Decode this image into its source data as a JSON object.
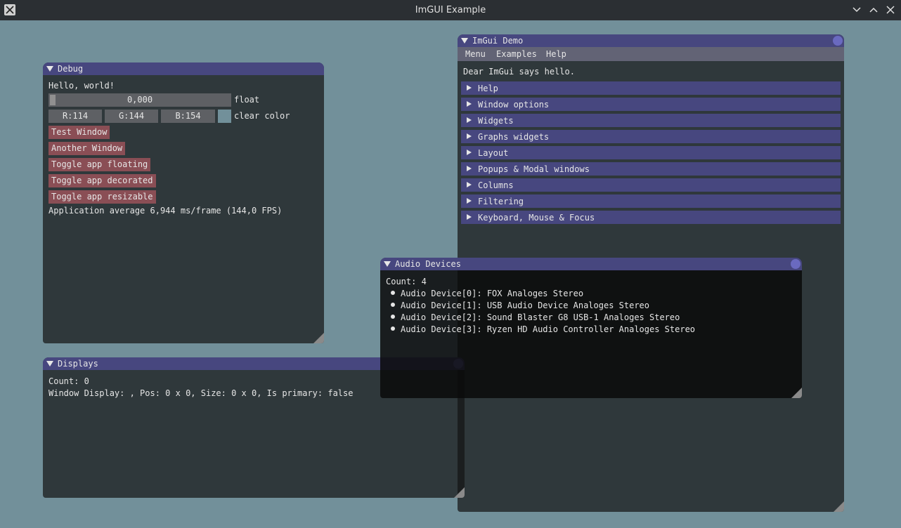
{
  "os": {
    "title": "ImGUI Example"
  },
  "debug": {
    "title": "Debug",
    "hello": "Hello, world!",
    "slider_value": "0,000",
    "slider_label": "float",
    "r": "R:114",
    "g": "G:144",
    "b": "B:154",
    "clear_color_label": "clear color",
    "clear_color": "#72909a",
    "buttons": [
      "Test Window",
      "Another Window",
      "Toggle app floating",
      "Toggle app decorated",
      "Toggle app resizable"
    ],
    "fps": "Application average 6,944 ms/frame (144,0 FPS)"
  },
  "demo": {
    "title": "ImGui Demo",
    "menus": [
      "Menu",
      "Examples",
      "Help"
    ],
    "hello": "Dear ImGui says hello.",
    "headers": [
      "Help",
      "Window options",
      "Widgets",
      "Graphs widgets",
      "Layout",
      "Popups & Modal windows",
      "Columns",
      "Filtering",
      "Keyboard, Mouse & Focus"
    ]
  },
  "audio": {
    "title": "Audio Devices",
    "count": "Count: 4",
    "devices": [
      "Audio Device[0]: FOX Analoges Stereo",
      "Audio Device[1]: USB Audio Device Analoges Stereo",
      "Audio Device[2]: Sound Blaster G8 USB-1 Analoges Stereo",
      "Audio Device[3]: Ryzen HD Audio Controller Analoges Stereo"
    ]
  },
  "displays": {
    "title": "Displays",
    "count": "Count: 0",
    "window_display": "Window Display: , Pos: 0 x 0, Size: 0 x 0, Is primary: false"
  }
}
